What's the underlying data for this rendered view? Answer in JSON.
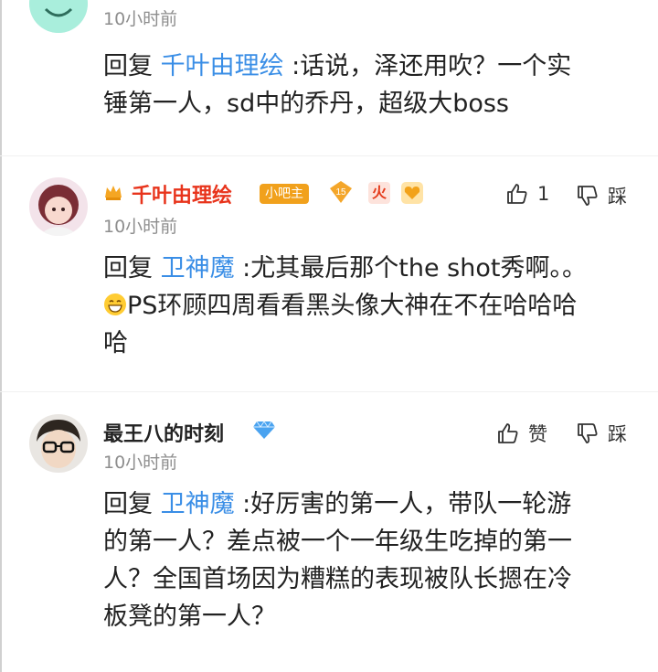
{
  "comments": [
    {
      "time": "10小时前",
      "reply_prefix": "回复",
      "reply_to": "千叶由理绘",
      "text_1": " :话说，泽还用吹？一个实",
      "text_2": "锤第一人，sd中的乔丹，超级大boss"
    },
    {
      "username": "千叶由理绘",
      "username_color": "#e8341c",
      "badge": "小吧主",
      "level": "15",
      "fire": "火",
      "time": "10小时前",
      "like_count": "1",
      "dislike_label": "踩",
      "reply_prefix": "回复",
      "reply_to": "卫神魔",
      "text_1": " :尤其最后那个the shot秀啊。。",
      "text_2": "PS环顾四周看看黑头像大神在不在哈哈哈",
      "text_3": "哈"
    },
    {
      "username": "最王八的时刻",
      "time": "10小时前",
      "like_label": "赞",
      "dislike_label": "踩",
      "reply_prefix": "回复",
      "reply_to": "卫神魔",
      "text_1": " :好厉害的第一人，带队一轮游",
      "text_2": "的第一人？差点被一个一年级生吃掉的第一",
      "text_3": "人？全国首场因为糟糕的表现被队长摁在冷",
      "text_4": "板凳的第一人？"
    }
  ],
  "colors": {
    "link": "#3a8ee6",
    "time": "#8e8e8e",
    "badge_bg": "#f1a11c"
  }
}
